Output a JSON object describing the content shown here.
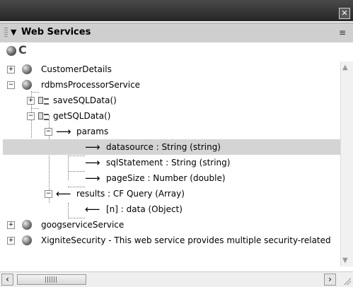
{
  "window": {
    "close_glyph": "✕"
  },
  "panel": {
    "arrow": "▼",
    "title": "Web Services",
    "menu_glyph": "≡"
  },
  "toolbar": {
    "refresh_glyph": "C"
  },
  "tree": {
    "items": [
      {
        "label": "CustomerDetails",
        "toggle": "+"
      },
      {
        "label": "rdbmsProcessorService",
        "toggle": "−"
      },
      {
        "label": "saveSQLData()",
        "toggle": "+"
      },
      {
        "label": "getSQLData()",
        "toggle": "−"
      },
      {
        "label": "params",
        "toggle": "−"
      },
      {
        "label": "datasource : String (string)"
      },
      {
        "label": "sqlStatement : String (string)"
      },
      {
        "label": "pageSize : Number (double)"
      },
      {
        "label": "results : CF Query (Array)",
        "toggle": "−"
      },
      {
        "label": "[n] : data (Object)"
      },
      {
        "label": "googserviceService",
        "toggle": "+"
      },
      {
        "label": "XigniteSecurity - This web service provides multiple security-related",
        "toggle": "+"
      }
    ],
    "selected_index": 5
  },
  "scrollbar": {
    "up": "▲",
    "down": "▼",
    "left": "‹",
    "right": "›"
  }
}
